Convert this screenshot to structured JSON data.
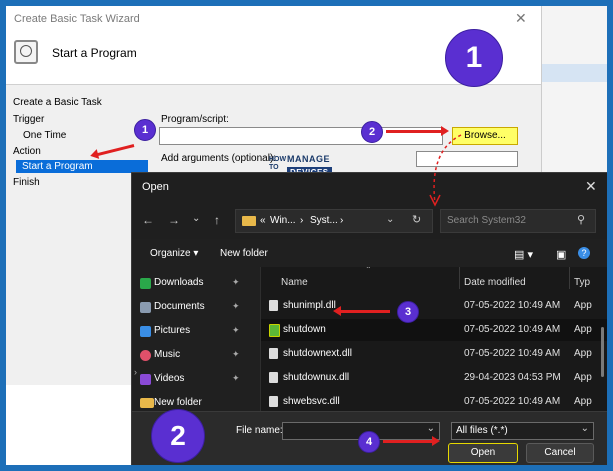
{
  "wizard": {
    "title": "Create Basic Task Wizard",
    "close_glyph": "✕",
    "heading": "Start a Program",
    "nav": [
      "Create a Basic Task",
      "Trigger",
      "One Time",
      "Action",
      "Start a Program",
      "Finish"
    ],
    "program_label": "Program/script:",
    "browse_label": "Browse...",
    "args_label": "Add arguments (optional):"
  },
  "logo": {
    "how": "HOW\nTO",
    "manage": "MANAGE",
    "devices": "DEVICES"
  },
  "dialog": {
    "title": "Open",
    "close_glyph": "✕",
    "address": [
      "«",
      "Win...",
      "›",
      "Syst...",
      "›"
    ],
    "search_placeholder": "Search System32",
    "toolbar": {
      "organize": "Organize ▾",
      "new_folder": "New folder"
    },
    "sidebar": [
      {
        "label": "Downloads",
        "color": "#2aa84a"
      },
      {
        "label": "Documents",
        "color": "#8a9bb0"
      },
      {
        "label": "Pictures",
        "color": "#3a8ee6"
      },
      {
        "label": "Music",
        "color": "#e0506a"
      },
      {
        "label": "Videos",
        "color": "#8a4ad6"
      },
      {
        "label": "New folder",
        "color": "#e8b84a"
      }
    ],
    "columns": {
      "name": "Name",
      "date": "Date modified",
      "type": "Typ"
    },
    "files": [
      {
        "name": "shunimpl.dll",
        "date": "07-05-2022 10:49 AM",
        "type": "App"
      },
      {
        "name": "shutdown",
        "date": "07-05-2022 10:49 AM",
        "type": "App"
      },
      {
        "name": "shutdownext.dll",
        "date": "07-05-2022 10:49 AM",
        "type": "App"
      },
      {
        "name": "shutdownux.dll",
        "date": "29-04-2023 04:53 PM",
        "type": "App"
      },
      {
        "name": "shwebsvc.dll",
        "date": "07-05-2022 10:49 AM",
        "type": "App"
      }
    ],
    "file_name_label": "File name:",
    "file_name_value": "",
    "filter": "All files (*.*)",
    "open_label": "Open",
    "cancel_label": "Cancel"
  },
  "badges": {
    "b1_big": "1",
    "b2_big": "2",
    "b1": "1",
    "b2": "2",
    "b3": "3",
    "b4": "4"
  }
}
